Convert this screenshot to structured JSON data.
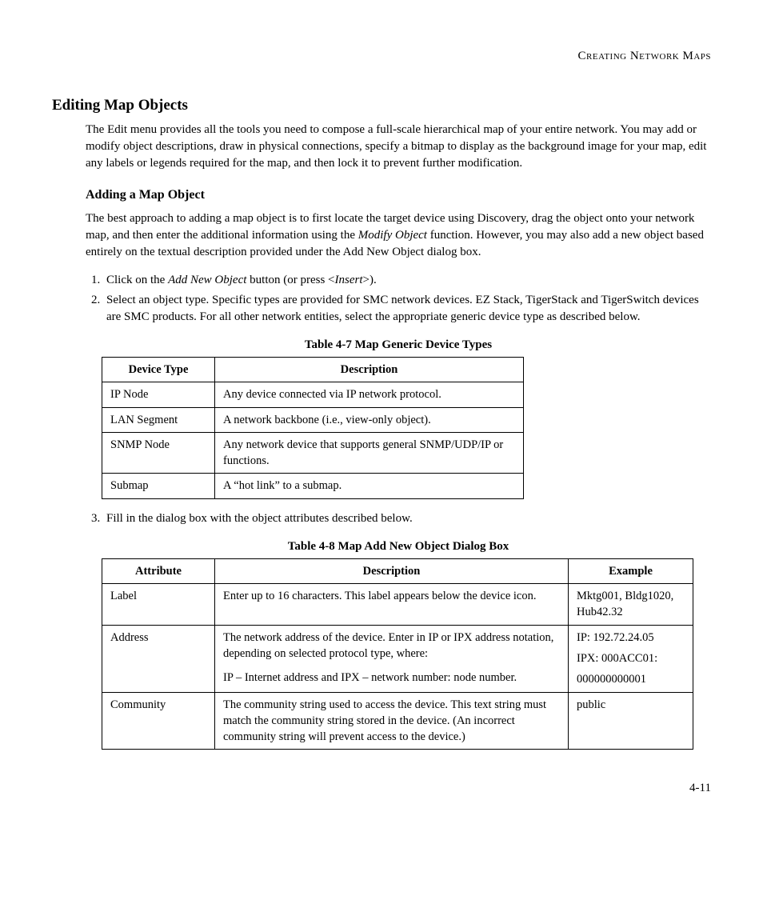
{
  "header": {
    "running_head": "Creating Network Maps"
  },
  "section": {
    "title": "Editing Map Objects",
    "intro": "The Edit menu provides all the tools you need to compose a full-scale hierarchical map of your entire network. You may add or modify object descriptions, draw in physical connections, specify a bitmap to display as the background image for your map, edit any labels or legends required for the map, and then lock it to prevent further modification."
  },
  "subsection": {
    "title": "Adding a Map Object",
    "intro_pre": "The best approach to adding a map object is to first locate the target device using Discovery, drag the object onto your network map, and then enter the additional information using the ",
    "intro_em": "Modify Object",
    "intro_post": " function. However, you may also add a new object based entirely on the textual description provided under the Add New Object dialog box.",
    "steps": {
      "s1_pre": "Click on the ",
      "s1_em1": "Add New Object",
      "s1_mid": " button (or press <",
      "s1_em2": "Insert",
      "s1_post": ">).",
      "s2": "Select an object type. Specific types are provided for SMC network devices. EZ Stack, TigerStack and TigerSwitch devices are SMC products. For all other network entities, select the appropriate generic device type as described below.",
      "s3": "Fill in the dialog box with the object attributes described below."
    }
  },
  "table1": {
    "caption": "Table 4-7  Map Generic Device Types",
    "headers": {
      "c1": "Device Type",
      "c2": "Description"
    },
    "rows": [
      {
        "c1": "IP Node",
        "c2": "Any device connected via IP network protocol."
      },
      {
        "c1": "LAN Segment",
        "c2": "A network backbone (i.e., view-only object)."
      },
      {
        "c1": "SNMP Node",
        "c2": "Any network device that supports general SNMP/UDP/IP or functions."
      },
      {
        "c1": "Submap",
        "c2": "A “hot link” to a submap."
      }
    ]
  },
  "table2": {
    "caption": "Table 4-8  Map Add New Object Dialog Box",
    "headers": {
      "c1": "Attribute",
      "c2": "Description",
      "c3": "Example"
    },
    "rows": [
      {
        "c1": "Label",
        "c2": "Enter up to 16 characters. This label appears below the device icon.",
        "c3a": "Mktg001, Bldg1020, Hub42.32"
      },
      {
        "c1": "Address",
        "c2a": "The network address of the device. Enter in IP or IPX address notation, depending on selected protocol type, where:",
        "c2b": "IP – Internet address and IPX – network number: node number.",
        "c3a": "IP: 192.72.24.05",
        "c3b": "IPX: 000ACC01:",
        "c3c": "000000000001"
      },
      {
        "c1": "Community",
        "c2": "The community string used to access the device. This text string must match the community string stored in the device. (An incorrect community string will prevent access to the device.)",
        "c3a": "public"
      }
    ]
  },
  "footer": {
    "page": "4-11"
  }
}
